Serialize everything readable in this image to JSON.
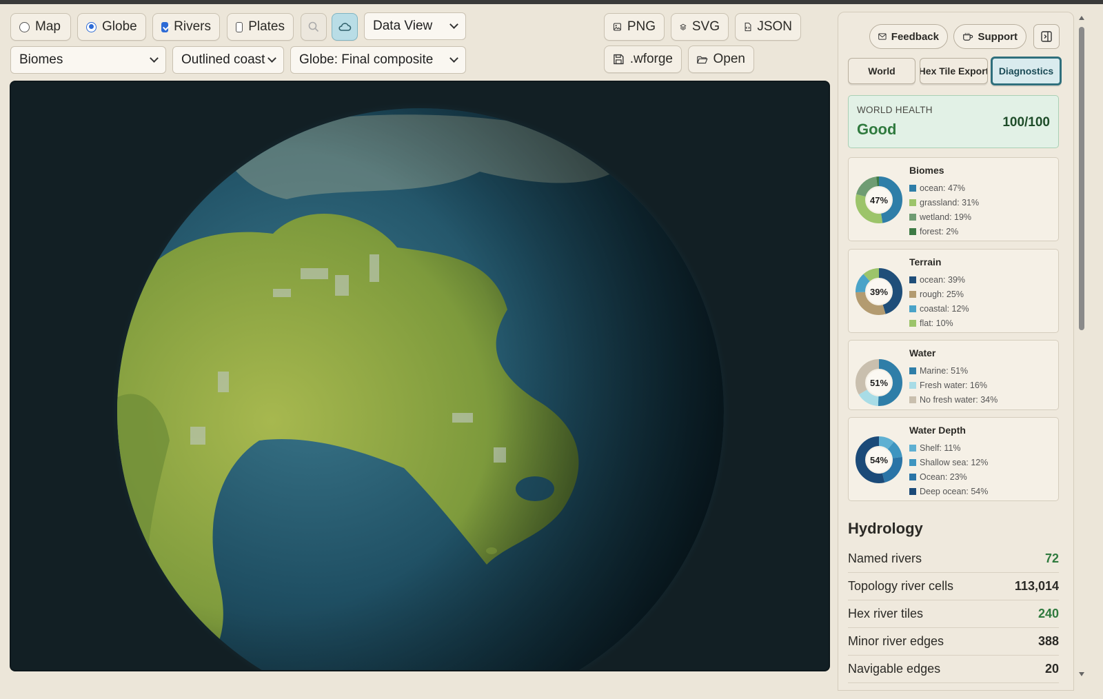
{
  "toolbar": {
    "view_map": "Map",
    "view_globe": "Globe",
    "rivers": "Rivers",
    "plates": "Plates",
    "data_view": "Data View",
    "layer_select": "Biomes",
    "coast_select": "Outlined coast",
    "globe_select": "Globe: Final composite",
    "png": "PNG",
    "svg": "SVG",
    "json": "JSON",
    "wforge": ".wforge",
    "open": "Open"
  },
  "panel": {
    "feedback": "Feedback",
    "support": "Support",
    "tabs": [
      "World",
      "Hex Tile Export",
      "Diagnostics"
    ],
    "health": {
      "label": "WORLD HEALTH",
      "status": "Good",
      "score": "100/100"
    },
    "cards": [
      {
        "title": "Biomes",
        "center": "47%",
        "items": [
          {
            "label": "ocean: 47%",
            "value": 47,
            "color": "#2f7ea8"
          },
          {
            "label": "grassland: 31%",
            "value": 31,
            "color": "#9cc46a"
          },
          {
            "label": "wetland: 19%",
            "value": 19,
            "color": "#6f9c73"
          },
          {
            "label": "forest: 2%",
            "value": 2,
            "color": "#3d7a45"
          }
        ]
      },
      {
        "title": "Terrain",
        "center": "39%",
        "items": [
          {
            "label": "ocean: 39%",
            "value": 39,
            "color": "#1f4e79"
          },
          {
            "label": "rough: 25%",
            "value": 25,
            "color": "#b39b70"
          },
          {
            "label": "coastal: 12%",
            "value": 12,
            "color": "#4aa3c8"
          },
          {
            "label": "flat: 10%",
            "value": 10,
            "color": "#9cc46a"
          }
        ]
      },
      {
        "title": "Water",
        "center": "51%",
        "items": [
          {
            "label": "Marine: 51%",
            "value": 51,
            "color": "#2f7ea8"
          },
          {
            "label": "Fresh water: 16%",
            "value": 16,
            "color": "#a8dce6"
          },
          {
            "label": "No fresh water: 34%",
            "value": 34,
            "color": "#c9bfae"
          }
        ]
      },
      {
        "title": "Water Depth",
        "center": "54%",
        "items": [
          {
            "label": "Shelf: 11%",
            "value": 11,
            "color": "#5fb0d2"
          },
          {
            "label": "Shallow sea: 12%",
            "value": 12,
            "color": "#3e95c0"
          },
          {
            "label": "Ocean: 23%",
            "value": 23,
            "color": "#2a74a6"
          },
          {
            "label": "Deep ocean: 54%",
            "value": 54,
            "color": "#1b4a78"
          }
        ]
      }
    ],
    "hydrology": {
      "title": "Hydrology",
      "stats": [
        {
          "label": "Named rivers",
          "value": "72",
          "green": true
        },
        {
          "label": "Topology river cells",
          "value": "113,014",
          "green": false
        },
        {
          "label": "Hex river tiles",
          "value": "240",
          "green": true
        },
        {
          "label": "Minor river edges",
          "value": "388",
          "green": false
        },
        {
          "label": "Navigable edges",
          "value": "20",
          "green": false
        }
      ]
    }
  }
}
